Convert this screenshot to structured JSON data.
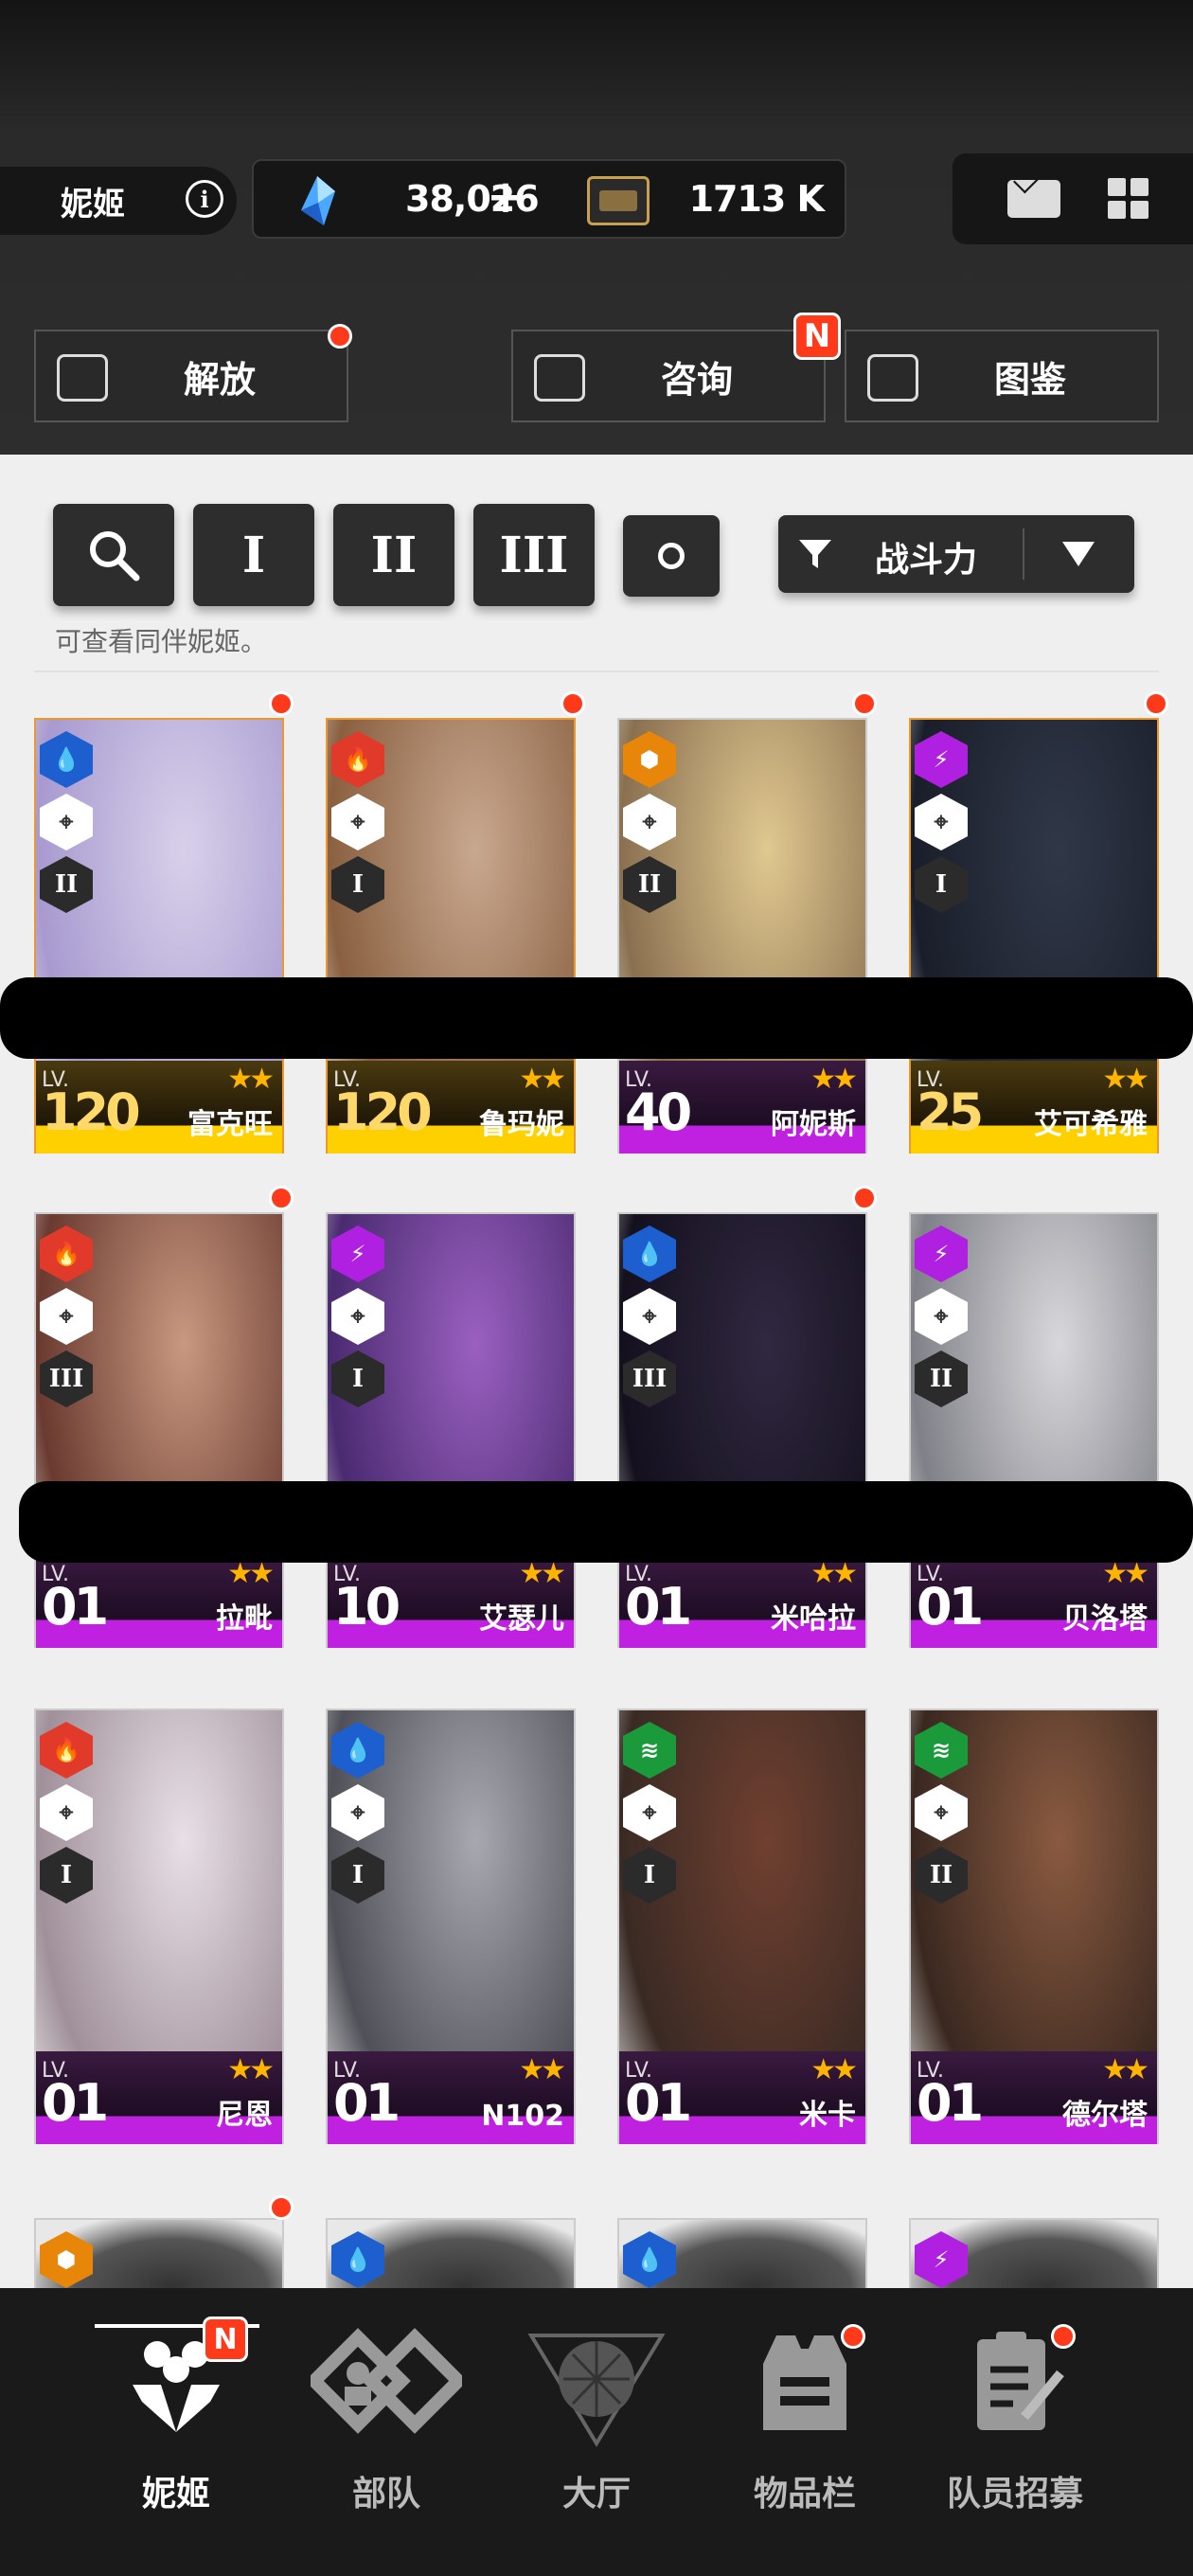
{
  "header": {
    "character_label": "妮姬",
    "info_icon": "info-icon",
    "gems": "38,026",
    "gems_plus": "+",
    "credits": "1713 K",
    "mail_icon": "mail-icon",
    "menu_icon": "grid-menu-icon"
  },
  "actions": {
    "release": "解放",
    "consult": "咨询",
    "consult_badge": "N",
    "codex": "图鉴"
  },
  "filters": {
    "search_icon": "search-icon",
    "burst_1": "I",
    "burst_2": "II",
    "burst_3": "III",
    "all_icon": "circle-icon",
    "sort_label": "战斗力",
    "hint": "可查看同伴妮姬。"
  },
  "cards": [
    {
      "name": "富克旺",
      "lv_label": "LV.",
      "level": "120",
      "rarity": "SSR",
      "element": "water",
      "element_color": "#1e5fd0",
      "burst": "II",
      "stars": "★★",
      "new": true
    },
    {
      "name": "鲁玛妮",
      "lv_label": "LV.",
      "level": "120",
      "rarity": "SSR",
      "element": "fire",
      "element_color": "#e23a2a",
      "burst": "I",
      "stars": "★★",
      "new": true
    },
    {
      "name": "阿妮斯",
      "lv_label": "LV.",
      "level": "40",
      "rarity": "SR",
      "element": "iron",
      "element_color": "#e8860a",
      "burst": "II",
      "stars": "★★",
      "new": true
    },
    {
      "name": "艾可希雅",
      "lv_label": "LV.",
      "level": "25",
      "rarity": "SSR",
      "element": "electric",
      "element_color": "#b020e0",
      "burst": "I",
      "stars": "★★",
      "new": true
    },
    {
      "name": "拉毗",
      "lv_label": "LV.",
      "level": "01",
      "rarity": "SR",
      "element": "fire",
      "element_color": "#e23a2a",
      "burst": "III",
      "stars": "★★",
      "new": true
    },
    {
      "name": "艾瑟儿",
      "lv_label": "LV.",
      "level": "10",
      "rarity": "SR",
      "element": "electric",
      "element_color": "#b020e0",
      "burst": "I",
      "stars": "★★",
      "new": false
    },
    {
      "name": "米哈拉",
      "lv_label": "LV.",
      "level": "01",
      "rarity": "SR",
      "element": "water",
      "element_color": "#1e5fd0",
      "burst": "III",
      "stars": "★★",
      "new": true
    },
    {
      "name": "贝洛塔",
      "lv_label": "LV.",
      "level": "01",
      "rarity": "SR",
      "element": "electric",
      "element_color": "#b020e0",
      "burst": "II",
      "stars": "★★",
      "new": false
    },
    {
      "name": "尼恩",
      "lv_label": "LV.",
      "level": "01",
      "rarity": "SR",
      "element": "fire",
      "element_color": "#e23a2a",
      "burst": "I",
      "stars": "★★",
      "new": false
    },
    {
      "name": "N102",
      "lv_label": "LV.",
      "level": "01",
      "rarity": "SR",
      "element": "water",
      "element_color": "#1e5fd0",
      "burst": "I",
      "stars": "★★",
      "new": false
    },
    {
      "name": "米卡",
      "lv_label": "LV.",
      "level": "01",
      "rarity": "SR",
      "element": "wind",
      "element_color": "#1a9a3a",
      "burst": "I",
      "stars": "★★",
      "new": false
    },
    {
      "name": "德尔塔",
      "lv_label": "LV.",
      "level": "01",
      "rarity": "SR",
      "element": "wind",
      "element_color": "#1a9a3a",
      "burst": "II",
      "stars": "★★",
      "new": false
    }
  ],
  "partial_row": [
    {
      "element": "iron",
      "element_color": "#e8860a",
      "new": true
    },
    {
      "element": "water",
      "element_color": "#1e5fd0",
      "new": false
    },
    {
      "element": "water",
      "element_color": "#1e5fd0",
      "new": false
    },
    {
      "element": "electric",
      "element_color": "#b020e0",
      "new": false
    }
  ],
  "nav": {
    "nikke": "妮姬",
    "nikke_badge": "N",
    "squad": "部队",
    "lobby": "大厅",
    "inventory": "物品栏",
    "recruit": "队员招募"
  }
}
